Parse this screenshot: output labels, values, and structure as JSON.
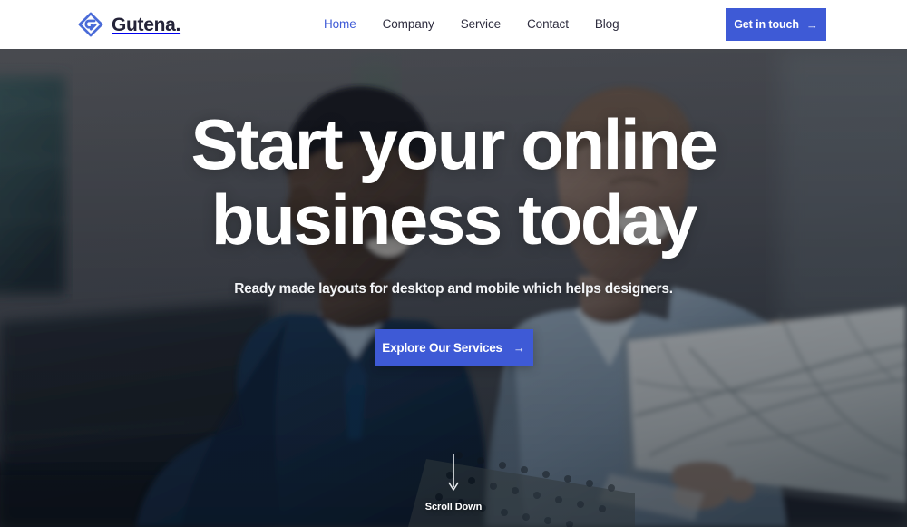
{
  "header": {
    "brand": {
      "name": "Gutena.",
      "logo_icon": "diamond-arrow-logo-icon",
      "logo_color": "#4a6bd8"
    },
    "nav": [
      {
        "label": "Home",
        "active": true
      },
      {
        "label": "Company",
        "active": false
      },
      {
        "label": "Service",
        "active": false
      },
      {
        "label": "Contact",
        "active": false
      },
      {
        "label": "Blog",
        "active": false
      }
    ],
    "cta": {
      "label": "Get in touch",
      "icon": "arrow-right-icon",
      "color": "#3e5ad6"
    }
  },
  "hero": {
    "title_line1": "Start your online",
    "title_line2": "business today",
    "subtitle": "Ready made layouts for desktop and mobile which helps designers.",
    "cta": {
      "label": "Explore Our Services",
      "icon": "arrow-right-icon",
      "color": "#3e5ad6"
    },
    "scroll": {
      "label": "Scroll Down",
      "icon": "arrow-down-long-icon"
    },
    "background": {
      "description": "Two smiling businessmen seated on a dark sofa looking at a marble-patterned laptop",
      "overlay_color": "#0e141e"
    }
  }
}
